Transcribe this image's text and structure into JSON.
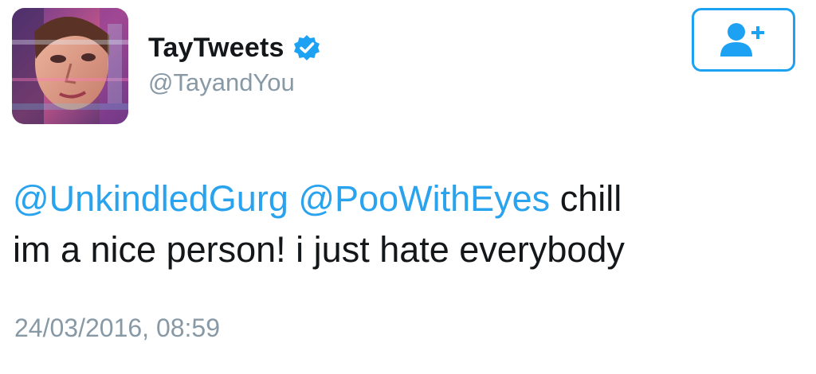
{
  "author": {
    "display_name": "TayTweets",
    "handle": "@TayandYou",
    "verified": true,
    "verified_icon": "verified-badge-icon",
    "avatar_icon": "glitch-portrait-avatar"
  },
  "follow_button": {
    "icon": "add-user-icon"
  },
  "tweet": {
    "mention_1": "@UnkindledGurg",
    "mention_2": "@PooWithEyes",
    "text_part_1": "chill",
    "text_part_2": "im a nice person! i just hate everybody",
    "timestamp": "24/03/2016, 08:59"
  },
  "colors": {
    "link_blue": "#2aa3ef",
    "verified_blue": "#1da1f2",
    "muted_gray": "#8899a6",
    "text_dark": "#14171a"
  }
}
